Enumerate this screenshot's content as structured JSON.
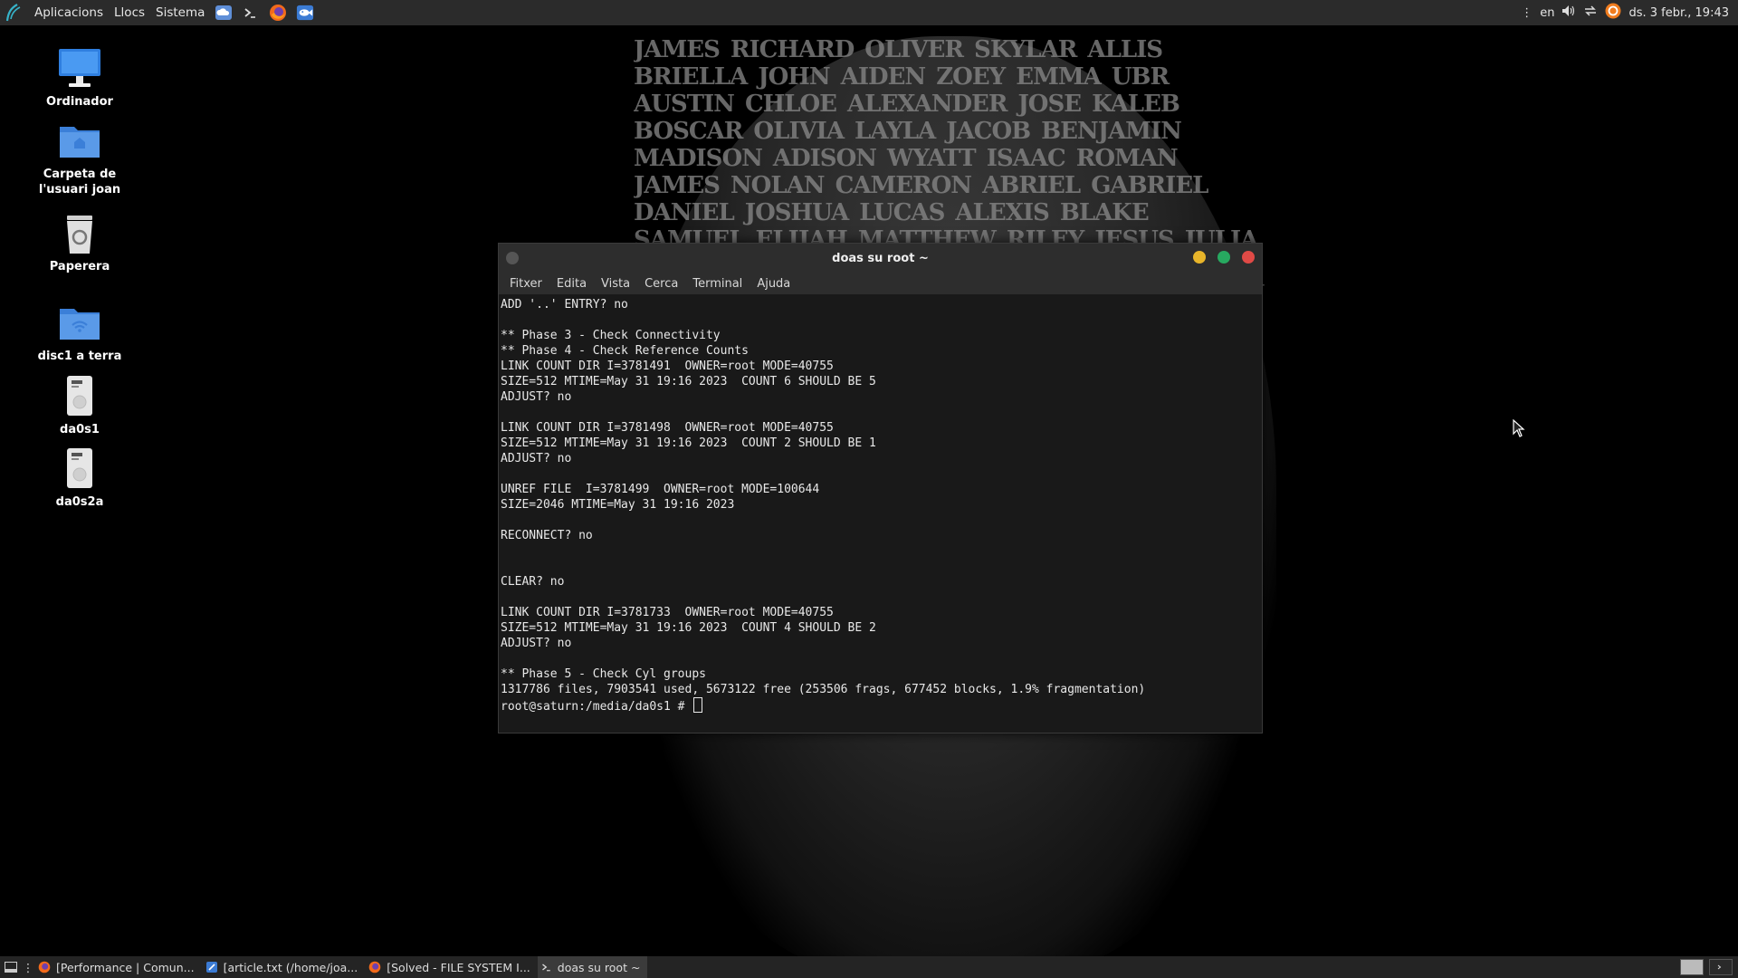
{
  "top_panel": {
    "menus": [
      "Aplicacions",
      "Llocs",
      "Sistema"
    ],
    "keyboard_layout": "en",
    "datetime": "ds. 3 febr., 19:43"
  },
  "desktop_icons": [
    {
      "label": "Ordinador",
      "icon": "computer-icon"
    },
    {
      "label": "Carpeta de l'usuari joan",
      "icon": "home-folder-icon"
    },
    {
      "label": "Paperera",
      "icon": "trash-icon"
    },
    {
      "label": "disc1 a terra",
      "icon": "network-folder-icon"
    },
    {
      "label": "da0s1",
      "icon": "drive-icon"
    },
    {
      "label": "da0s2a",
      "icon": "drive-icon"
    }
  ],
  "terminal": {
    "title": "doas su root ~",
    "menu": [
      "Fitxer",
      "Edita",
      "Vista",
      "Cerca",
      "Terminal",
      "Ajuda"
    ],
    "lines": [
      "ADD '..' ENTRY? no",
      "",
      "** Phase 3 - Check Connectivity",
      "** Phase 4 - Check Reference Counts",
      "LINK COUNT DIR I=3781491  OWNER=root MODE=40755",
      "SIZE=512 MTIME=May 31 19:16 2023  COUNT 6 SHOULD BE 5",
      "ADJUST? no",
      "",
      "LINK COUNT DIR I=3781498  OWNER=root MODE=40755",
      "SIZE=512 MTIME=May 31 19:16 2023  COUNT 2 SHOULD BE 1",
      "ADJUST? no",
      "",
      "UNREF FILE  I=3781499  OWNER=root MODE=100644",
      "SIZE=2046 MTIME=May 31 19:16 2023",
      "",
      "RECONNECT? no",
      "",
      "",
      "CLEAR? no",
      "",
      "LINK COUNT DIR I=3781733  OWNER=root MODE=40755",
      "SIZE=512 MTIME=May 31 19:16 2023  COUNT 4 SHOULD BE 2",
      "ADJUST? no",
      "",
      "** Phase 5 - Check Cyl groups",
      "1317786 files, 7903541 used, 5673122 free (253506 frags, 677452 blocks, 1.9% fragmentation)"
    ],
    "prompt": "root@saturn:/media/da0s1 # "
  },
  "taskbar": {
    "tasks": [
      {
        "label": "[Performance | Comun...",
        "icon": "firefox-icon",
        "active": false
      },
      {
        "label": "[article.txt (/home/joa...",
        "icon": "text-editor-icon",
        "active": false
      },
      {
        "label": "[Solved - FILE SYSTEM I...",
        "icon": "firefox-icon",
        "active": false
      },
      {
        "label": "doas su root ~",
        "icon": "terminal-icon",
        "active": true
      }
    ]
  },
  "wallpaper": {
    "words": "JAMES RICHARD OLIVER SKYLAR ALLIS BRIELLA JOHN AIDEN ZOEY EMMA UBR AUSTIN CHLOE ALEXANDER JOSE KALEB BOSCAR OLIVIA LAYLA JACOB BENJAMIN MADISON ADISON WYATT ISAAC ROMAN JAMES NOLAN CAMERON ABRIEL GABRIEL DANIEL JOSHUA LUCAS ALEXIS BLAKE SAMUEL ELIJAH MATTHEW RILEY JESUS JULIA CHRISTIAN HAYDEN AVA COLLIN ELLA ISABELLA MILA LIAM JORDAN NATHAN ETHAN LOGAN RYAN BRYAN LILY GRACE MASON HENRY AUDREY CONNOR JACK OWEN DYLAN KEVIN TAYLOR EVAN AUBREY CALEB PETER JACKSON SOPHIA ANGEL ALEXANDRA SEBASTIAN DESTINY JUSTIN TIMOTHY PATRICK ERIC SOFIA ISAAC SAWYER ABIGAIL LEAH MICHAEL LUKE JACOB FAITH BRADLEY HAILEY ARIA MARIAH REESE ALEXA EVA LEVI ANDREW CARSON DAMIAN OLIVER ADAM AYDEN PAIGE KINGSTON BRYSON CARLOS"
  }
}
